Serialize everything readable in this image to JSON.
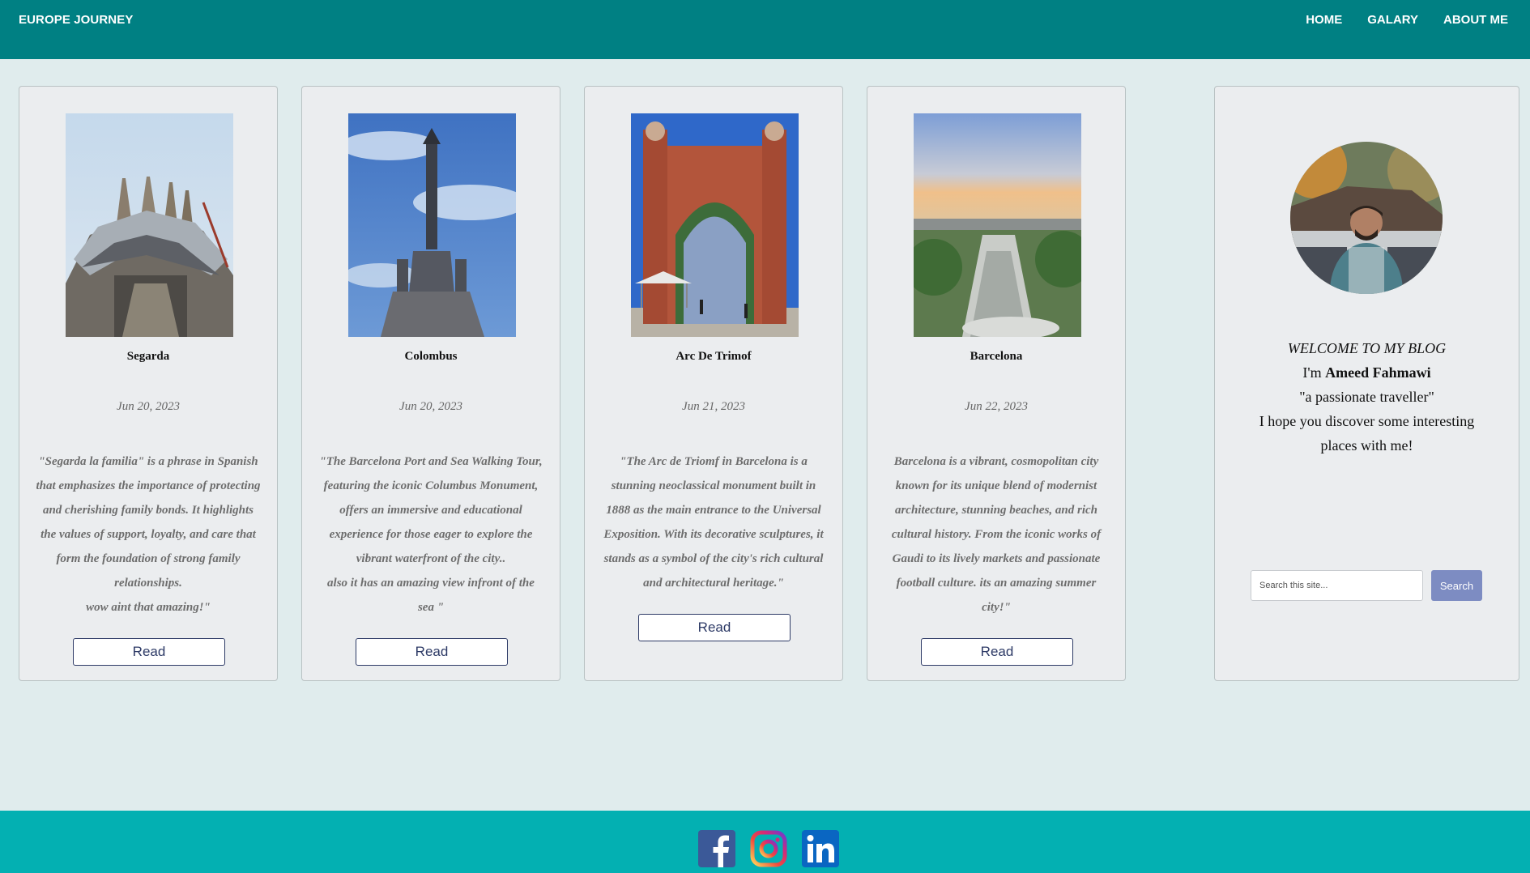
{
  "header": {
    "brand": "EUROPE JOURNEY",
    "nav": [
      {
        "label": "HOME"
      },
      {
        "label": "GALARY"
      },
      {
        "label": "ABOUT ME"
      }
    ]
  },
  "posts": [
    {
      "title": "Segarda",
      "date": "Jun 20, 2023",
      "text": "\"Segarda la familia\" is a phrase in Spanish\nthat emphasizes the importance of protecting\nand cherishing family bonds. It highlights\nthe values of support, loyalty, and care that\nform the foundation of strong family\nrelationships.\nwow aint that amazing!\"",
      "button": "Read",
      "image_icon": "sagrada-familia-photo"
    },
    {
      "title": "Colombus",
      "date": "Jun 20, 2023",
      "text": "\"The Barcelona Port and Sea Walking Tour,\nfeaturing the iconic Columbus Monument,\noffers an immersive and educational\nexperience for those eager to explore the\nvibrant waterfront of the city..\nalso it has an amazing view infront of the\nsea \"",
      "button": "Read",
      "image_icon": "columbus-monument-photo"
    },
    {
      "title": "Arc De Trimof",
      "date": "Jun 21, 2023",
      "text": "\"The Arc de Triomf in Barcelona is a\nstunning neoclassical monument built in\n1888 as the main entrance to the Universal\nExposition. With its decorative sculptures, it\nstands as a symbol of the city's rich cultural\nand architectural heritage.\"",
      "button": "Read",
      "image_icon": "arc-de-triomf-photo"
    },
    {
      "title": "Barcelona",
      "date": "Jun 22, 2023",
      "text": "Barcelona is a vibrant, cosmopolitan city\nknown for its unique blend of modernist\narchitecture, stunning beaches, and rich\ncultural history. From the iconic works of\nGaudi to its lively markets and passionate\nfootball culture. its an amazing summer\ncity!\"",
      "button": "Read",
      "image_icon": "barcelona-skyline-photo"
    }
  ],
  "profile": {
    "welcome": "WELCOME TO MY BLOG",
    "im": "I'm ",
    "name": "Ameed Fahmawi",
    "tagline": "\"a passionate traveller\"",
    "message": "I hope you discover some interesting places with me!",
    "search_placeholder": "Search this site...",
    "search_button": "Search"
  },
  "footer": {
    "social": [
      "facebook-icon",
      "instagram-icon",
      "linkedin-icon"
    ]
  },
  "colors": {
    "navbar": "#008083",
    "footer": "#03b0b2",
    "background": "#e0eced",
    "card": "#ebedef",
    "search_button": "#7d8cc2"
  }
}
